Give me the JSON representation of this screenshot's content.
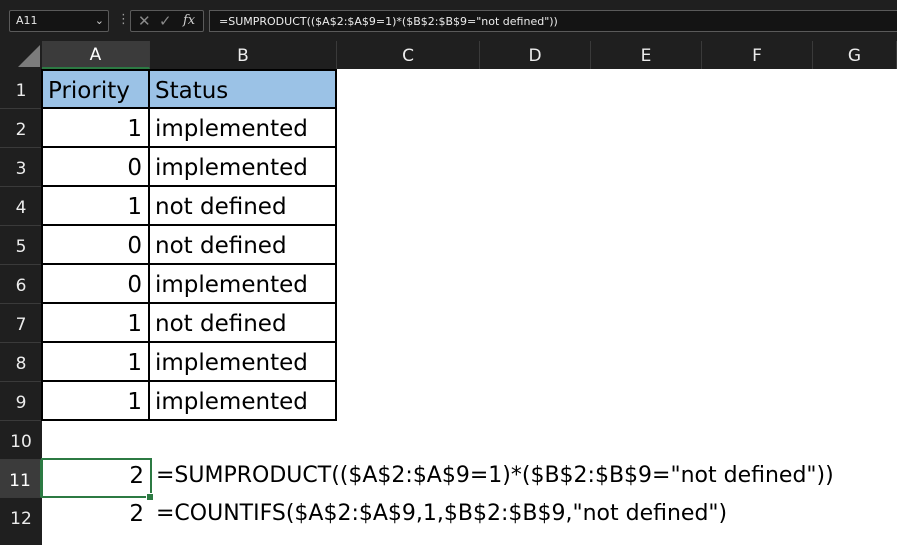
{
  "formula_bar": {
    "name_box": "A11",
    "name_box_caret": "⌄",
    "cancel_glyph": "✕",
    "enter_glyph": "✓",
    "fx_label": "fx",
    "formula": "=SUMPRODUCT(($A$2:$A$9=1)*($B$2:$B$9=\"not defined\"))"
  },
  "columns": [
    "A",
    "B",
    "C",
    "D",
    "E",
    "F",
    "G"
  ],
  "rows": [
    "1",
    "2",
    "3",
    "4",
    "5",
    "6",
    "7",
    "8",
    "9",
    "10",
    "11",
    "12"
  ],
  "table": {
    "headers": {
      "priority": "Priority",
      "status": "Status"
    },
    "data": [
      {
        "priority": "1",
        "status": "implemented"
      },
      {
        "priority": "0",
        "status": "implemented"
      },
      {
        "priority": "1",
        "status": "not defined"
      },
      {
        "priority": "0",
        "status": "not defined"
      },
      {
        "priority": "0",
        "status": "implemented"
      },
      {
        "priority": "1",
        "status": "not defined"
      },
      {
        "priority": "1",
        "status": "implemented"
      },
      {
        "priority": "1",
        "status": "implemented"
      }
    ]
  },
  "results": [
    {
      "value": "2",
      "formula_text": "=SUMPRODUCT(($A$2:$A$9=1)*($B$2:$B$9=\"not defined\"))"
    },
    {
      "value": "2",
      "formula_text": "=COUNTIFS($A$2:$A$9,1,$B$2:$B$9,\"not defined\")"
    }
  ],
  "colors": {
    "header_fill": "#9bc2e6",
    "selection_green": "#2c7a43",
    "chrome_dark": "#1f1f1f"
  }
}
